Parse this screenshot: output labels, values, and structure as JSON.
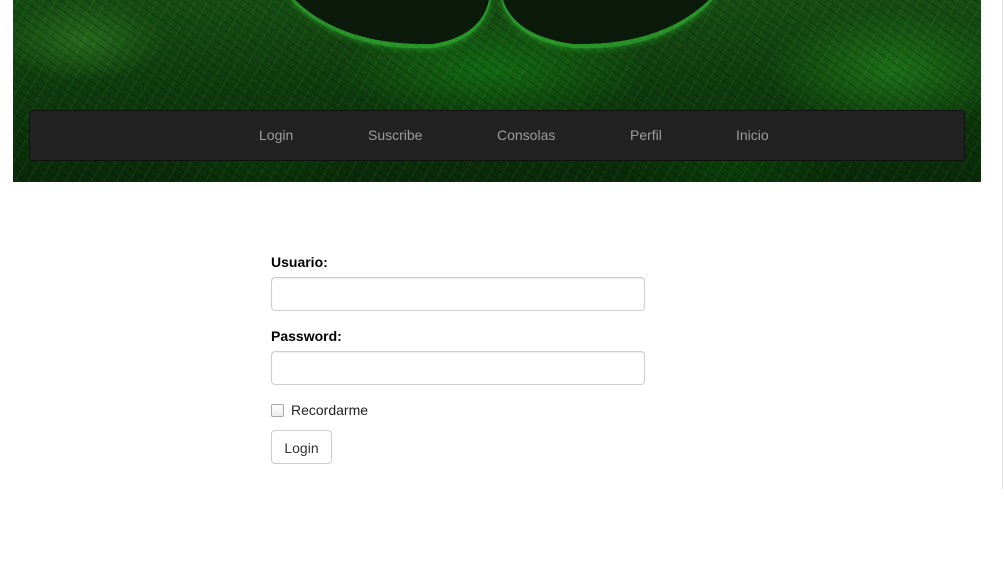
{
  "header": {
    "banner_image": "green-grunge-mustache-banner"
  },
  "navbar": {
    "items": [
      {
        "label": "Login"
      },
      {
        "label": "Suscribe"
      },
      {
        "label": "Consolas"
      },
      {
        "label": "Perfil"
      },
      {
        "label": "Inicio"
      }
    ]
  },
  "form": {
    "username_label": "Usuario:",
    "username_value": "",
    "password_label": "Password:",
    "password_value": "",
    "remember_label": "Recordarme",
    "remember_checked": false,
    "submit_label": "Login"
  },
  "colors": {
    "navbar_bg": "#222222",
    "navbar_text": "#9d9d9d",
    "banner_green": "#1a5c16"
  }
}
